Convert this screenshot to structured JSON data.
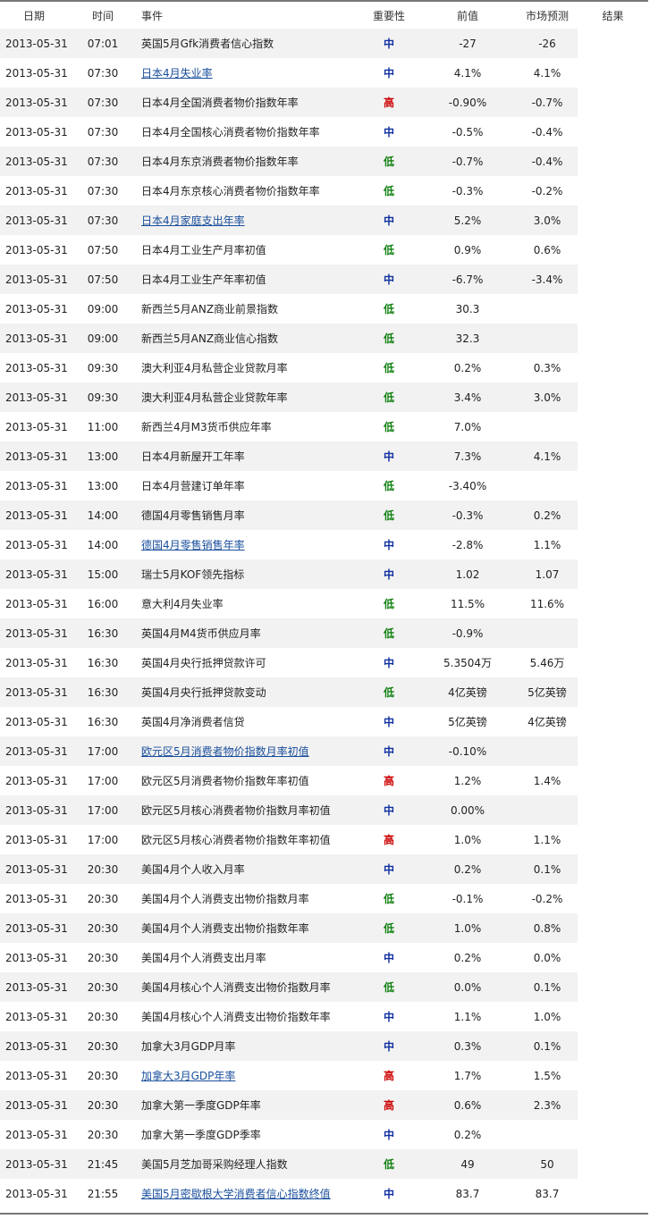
{
  "headers": {
    "date": "日期",
    "time": "时间",
    "event": "事件",
    "importance": "重要性",
    "previous": "前值",
    "forecast": "市场预测",
    "result": "结果"
  },
  "colors": {
    "high": "#cc0000",
    "mid": "#1030a0",
    "low": "#108010",
    "link": "#1a4f9c",
    "row_shade": "#f2f2f2"
  },
  "rows": [
    {
      "date": "2013-05-31",
      "time": "07:01",
      "event": "英国5月Gfk消费者信心指数",
      "link": false,
      "importance": "中",
      "level": "mid",
      "previous": "-27",
      "forecast": "-26",
      "result": ""
    },
    {
      "date": "2013-05-31",
      "time": "07:30",
      "event": "日本4月失业率",
      "link": true,
      "importance": "中",
      "level": "mid",
      "previous": "4.1%",
      "forecast": "4.1%",
      "result": ""
    },
    {
      "date": "2013-05-31",
      "time": "07:30",
      "event": "日本4月全国消费者物价指数年率",
      "link": false,
      "importance": "高",
      "level": "high",
      "previous": "-0.90%",
      "forecast": "-0.7%",
      "result": ""
    },
    {
      "date": "2013-05-31",
      "time": "07:30",
      "event": "日本4月全国核心消费者物价指数年率",
      "link": false,
      "importance": "中",
      "level": "mid",
      "previous": "-0.5%",
      "forecast": "-0.4%",
      "result": ""
    },
    {
      "date": "2013-05-31",
      "time": "07:30",
      "event": "日本4月东京消费者物价指数年率",
      "link": false,
      "importance": "低",
      "level": "low",
      "previous": "-0.7%",
      "forecast": "-0.4%",
      "result": ""
    },
    {
      "date": "2013-05-31",
      "time": "07:30",
      "event": "日本4月东京核心消费者物价指数年率",
      "link": false,
      "importance": "低",
      "level": "low",
      "previous": "-0.3%",
      "forecast": "-0.2%",
      "result": ""
    },
    {
      "date": "2013-05-31",
      "time": "07:30",
      "event": "日本4月家庭支出年率",
      "link": true,
      "importance": "中",
      "level": "mid",
      "previous": "5.2%",
      "forecast": "3.0%",
      "result": ""
    },
    {
      "date": "2013-05-31",
      "time": "07:50",
      "event": "日本4月工业生产月率初值",
      "link": false,
      "importance": "低",
      "level": "low",
      "previous": "0.9%",
      "forecast": "0.6%",
      "result": ""
    },
    {
      "date": "2013-05-31",
      "time": "07:50",
      "event": "日本4月工业生产年率初值",
      "link": false,
      "importance": "中",
      "level": "mid",
      "previous": "-6.7%",
      "forecast": "-3.4%",
      "result": ""
    },
    {
      "date": "2013-05-31",
      "time": "09:00",
      "event": "新西兰5月ANZ商业前景指数",
      "link": false,
      "importance": "低",
      "level": "low",
      "previous": "30.3",
      "forecast": "",
      "result": ""
    },
    {
      "date": "2013-05-31",
      "time": "09:00",
      "event": "新西兰5月ANZ商业信心指数",
      "link": false,
      "importance": "低",
      "level": "low",
      "previous": "32.3",
      "forecast": "",
      "result": ""
    },
    {
      "date": "2013-05-31",
      "time": "09:30",
      "event": "澳大利亚4月私营企业贷款月率",
      "link": false,
      "importance": "低",
      "level": "low",
      "previous": "0.2%",
      "forecast": "0.3%",
      "result": ""
    },
    {
      "date": "2013-05-31",
      "time": "09:30",
      "event": "澳大利亚4月私营企业贷款年率",
      "link": false,
      "importance": "低",
      "level": "low",
      "previous": "3.4%",
      "forecast": "3.0%",
      "result": ""
    },
    {
      "date": "2013-05-31",
      "time": "11:00",
      "event": "新西兰4月M3货币供应年率",
      "link": false,
      "importance": "低",
      "level": "low",
      "previous": "7.0%",
      "forecast": "",
      "result": ""
    },
    {
      "date": "2013-05-31",
      "time": "13:00",
      "event": "日本4月新屋开工年率",
      "link": false,
      "importance": "中",
      "level": "mid",
      "previous": "7.3%",
      "forecast": "4.1%",
      "result": ""
    },
    {
      "date": "2013-05-31",
      "time": "13:00",
      "event": "日本4月营建订单年率",
      "link": false,
      "importance": "低",
      "level": "low",
      "previous": "-3.40%",
      "forecast": "",
      "result": ""
    },
    {
      "date": "2013-05-31",
      "time": "14:00",
      "event": "德国4月零售销售月率",
      "link": false,
      "importance": "低",
      "level": "low",
      "previous": "-0.3%",
      "forecast": "0.2%",
      "result": ""
    },
    {
      "date": "2013-05-31",
      "time": "14:00",
      "event": "德国4月零售销售年率",
      "link": true,
      "importance": "中",
      "level": "mid",
      "previous": "-2.8%",
      "forecast": "1.1%",
      "result": ""
    },
    {
      "date": "2013-05-31",
      "time": "15:00",
      "event": "瑞士5月KOF领先指标",
      "link": false,
      "importance": "中",
      "level": "mid",
      "previous": "1.02",
      "forecast": "1.07",
      "result": ""
    },
    {
      "date": "2013-05-31",
      "time": "16:00",
      "event": "意大利4月失业率",
      "link": false,
      "importance": "低",
      "level": "low",
      "previous": "11.5%",
      "forecast": "11.6%",
      "result": ""
    },
    {
      "date": "2013-05-31",
      "time": "16:30",
      "event": "英国4月M4货币供应月率",
      "link": false,
      "importance": "低",
      "level": "low",
      "previous": "-0.9%",
      "forecast": "",
      "result": ""
    },
    {
      "date": "2013-05-31",
      "time": "16:30",
      "event": "英国4月央行抵押贷款许可",
      "link": false,
      "importance": "中",
      "level": "mid",
      "previous": "5.3504万",
      "forecast": "5.46万",
      "result": ""
    },
    {
      "date": "2013-05-31",
      "time": "16:30",
      "event": "英国4月央行抵押贷款变动",
      "link": false,
      "importance": "低",
      "level": "low",
      "previous": "4亿英镑",
      "forecast": "5亿英镑",
      "result": ""
    },
    {
      "date": "2013-05-31",
      "time": "16:30",
      "event": "英国4月净消费者信贷",
      "link": false,
      "importance": "中",
      "level": "mid",
      "previous": "5亿英镑",
      "forecast": "4亿英镑",
      "result": ""
    },
    {
      "date": "2013-05-31",
      "time": "17:00",
      "event": "欧元区5月消费者物价指数月率初值",
      "link": true,
      "importance": "中",
      "level": "mid",
      "previous": "-0.10%",
      "forecast": "",
      "result": ""
    },
    {
      "date": "2013-05-31",
      "time": "17:00",
      "event": "欧元区5月消费者物价指数年率初值",
      "link": false,
      "importance": "高",
      "level": "high",
      "previous": "1.2%",
      "forecast": "1.4%",
      "result": ""
    },
    {
      "date": "2013-05-31",
      "time": "17:00",
      "event": "欧元区5月核心消费者物价指数月率初值",
      "link": false,
      "importance": "中",
      "level": "mid",
      "previous": "0.00%",
      "forecast": "",
      "result": ""
    },
    {
      "date": "2013-05-31",
      "time": "17:00",
      "event": "欧元区5月核心消费者物价指数年率初值",
      "link": false,
      "importance": "高",
      "level": "high",
      "previous": "1.0%",
      "forecast": "1.1%",
      "result": ""
    },
    {
      "date": "2013-05-31",
      "time": "20:30",
      "event": "美国4月个人收入月率",
      "link": false,
      "importance": "中",
      "level": "mid",
      "previous": "0.2%",
      "forecast": "0.1%",
      "result": ""
    },
    {
      "date": "2013-05-31",
      "time": "20:30",
      "event": "美国4月个人消费支出物价指数月率",
      "link": false,
      "importance": "低",
      "level": "low",
      "previous": "-0.1%",
      "forecast": "-0.2%",
      "result": ""
    },
    {
      "date": "2013-05-31",
      "time": "20:30",
      "event": "美国4月个人消费支出物价指数年率",
      "link": false,
      "importance": "低",
      "level": "low",
      "previous": "1.0%",
      "forecast": "0.8%",
      "result": ""
    },
    {
      "date": "2013-05-31",
      "time": "20:30",
      "event": "美国4月个人消费支出月率",
      "link": false,
      "importance": "中",
      "level": "mid",
      "previous": "0.2%",
      "forecast": "0.0%",
      "result": ""
    },
    {
      "date": "2013-05-31",
      "time": "20:30",
      "event": "美国4月核心个人消费支出物价指数月率",
      "link": false,
      "importance": "低",
      "level": "low",
      "previous": "0.0%",
      "forecast": "0.1%",
      "result": ""
    },
    {
      "date": "2013-05-31",
      "time": "20:30",
      "event": "美国4月核心个人消费支出物价指数年率",
      "link": false,
      "importance": "中",
      "level": "mid",
      "previous": "1.1%",
      "forecast": "1.0%",
      "result": ""
    },
    {
      "date": "2013-05-31",
      "time": "20:30",
      "event": "加拿大3月GDP月率",
      "link": false,
      "importance": "中",
      "level": "mid",
      "previous": "0.3%",
      "forecast": "0.1%",
      "result": ""
    },
    {
      "date": "2013-05-31",
      "time": "20:30",
      "event": "加拿大3月GDP年率",
      "link": true,
      "importance": "高",
      "level": "high",
      "previous": "1.7%",
      "forecast": "1.5%",
      "result": ""
    },
    {
      "date": "2013-05-31",
      "time": "20:30",
      "event": "加拿大第一季度GDP年率",
      "link": false,
      "importance": "高",
      "level": "high",
      "previous": "0.6%",
      "forecast": "2.3%",
      "result": ""
    },
    {
      "date": "2013-05-31",
      "time": "20:30",
      "event": "加拿大第一季度GDP季率",
      "link": false,
      "importance": "中",
      "level": "mid",
      "previous": "0.2%",
      "forecast": "",
      "result": ""
    },
    {
      "date": "2013-05-31",
      "time": "21:45",
      "event": "美国5月芝加哥采购经理人指数",
      "link": false,
      "importance": "低",
      "level": "low",
      "previous": "49",
      "forecast": "50",
      "result": ""
    },
    {
      "date": "2013-05-31",
      "time": "21:55",
      "event": "美国5月密歇根大学消费者信心指数终值",
      "link": true,
      "importance": "中",
      "level": "mid",
      "previous": "83.7",
      "forecast": "83.7",
      "result": ""
    }
  ]
}
